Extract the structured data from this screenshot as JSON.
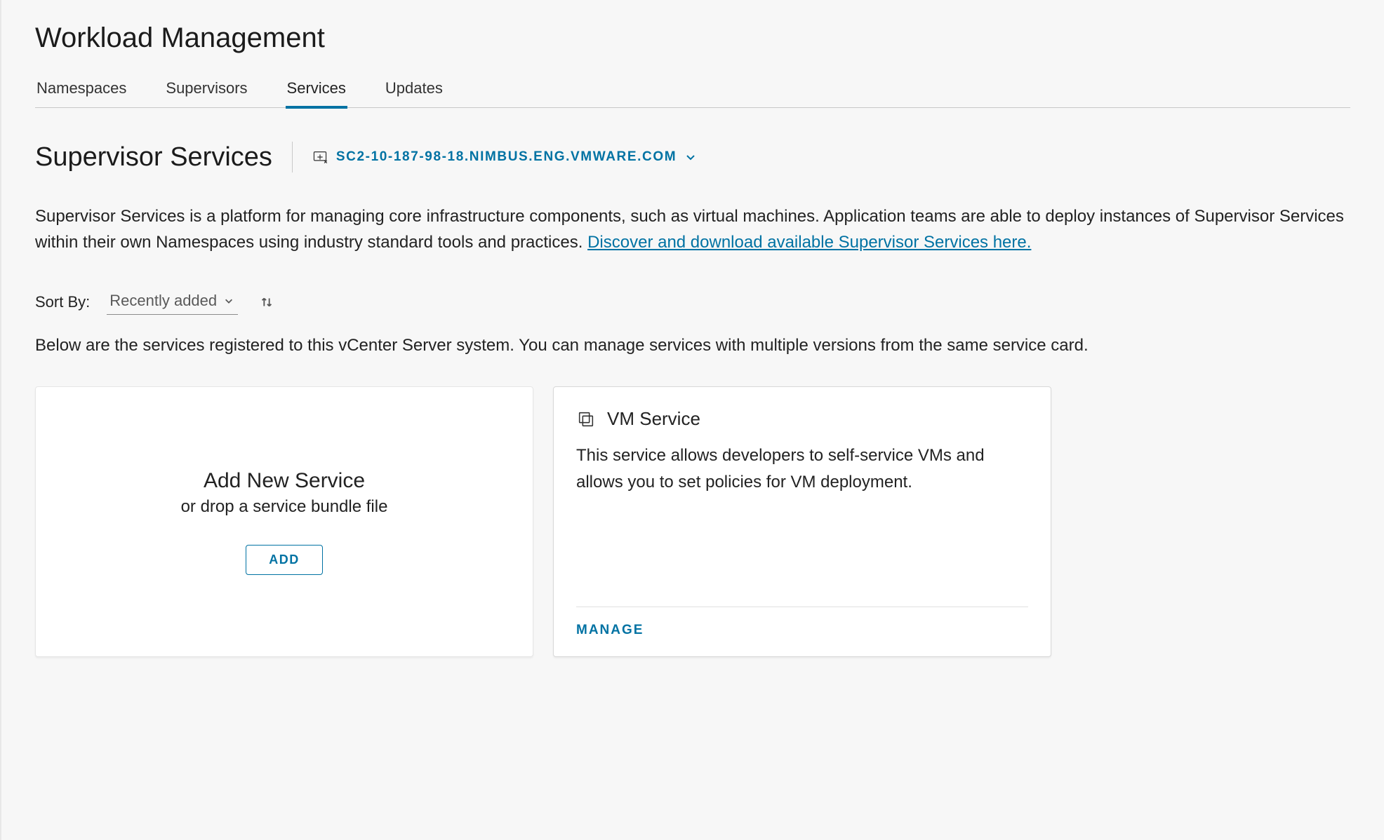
{
  "page_title": "Workload Management",
  "tabs": [
    {
      "label": "Namespaces"
    },
    {
      "label": "Supervisors"
    },
    {
      "label": "Services"
    },
    {
      "label": "Updates"
    }
  ],
  "active_tab_index": 2,
  "sub_title": "Supervisor Services",
  "vcenter_link": "SC2-10-187-98-18.NIMBUS.ENG.VMWARE.COM",
  "description_prefix": "Supervisor Services is a platform for managing core infrastructure components, such as virtual machines. Application teams are able to deploy instances of Supervisor Services within their own Namespaces using industry standard tools and practices. ",
  "description_link": "Discover and download available Supervisor Services here.",
  "sort_label": "Sort By:",
  "sort_value": "Recently added",
  "sub_desc": "Below are the services registered to this vCenter Server system. You can manage services with multiple versions from the same service card.",
  "add_card": {
    "title": "Add New Service",
    "subtitle": "or drop a service bundle file",
    "button": "ADD"
  },
  "service_card": {
    "title": "VM Service",
    "body": "This service allows developers to self-service VMs and allows you to set policies for VM deployment.",
    "manage": "MANAGE"
  }
}
